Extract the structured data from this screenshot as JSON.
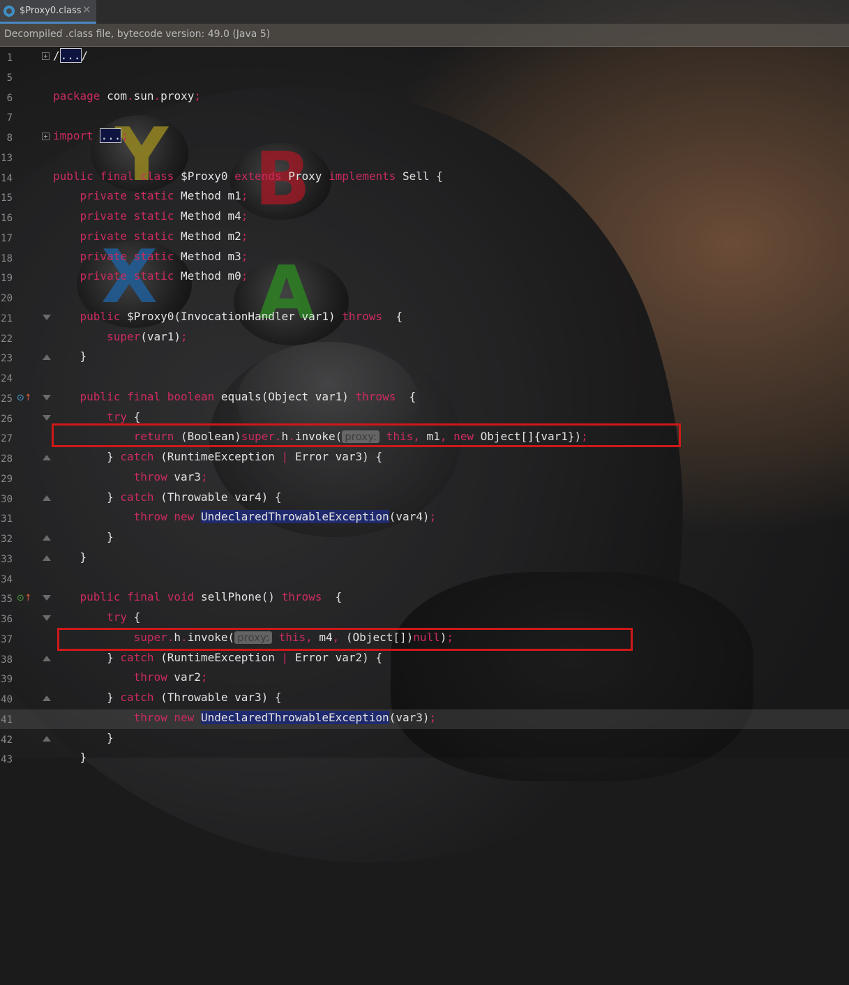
{
  "tab": {
    "icon": "class-file-icon",
    "label": "$Proxy0.class",
    "close": "✕"
  },
  "banner": {
    "text": "Decompiled .class file, bytecode version: 49.0 (Java 5)"
  },
  "hints": {
    "proxy": "proxy:"
  },
  "colors": {
    "keyword": "#cc2b5e",
    "identifier": "#e3e3e3",
    "selection": "#1f2a6e",
    "highlight_box": "#d01818"
  },
  "lines": [
    {
      "n": "1",
      "fold": "plus",
      "code": "/.../"
    },
    {
      "n": "5",
      "fold": "",
      "code": ""
    },
    {
      "n": "6",
      "fold": "",
      "code": "package com.sun.proxy;"
    },
    {
      "n": "7",
      "fold": "",
      "code": ""
    },
    {
      "n": "8",
      "fold": "plus",
      "code": "import ...;"
    },
    {
      "n": "13",
      "fold": "",
      "code": ""
    },
    {
      "n": "14",
      "fold": "",
      "code": "public final class $Proxy0 extends Proxy implements Sell {"
    },
    {
      "n": "15",
      "fold": "",
      "code": "    private static Method m1;"
    },
    {
      "n": "16",
      "fold": "",
      "code": "    private static Method m4;"
    },
    {
      "n": "17",
      "fold": "",
      "code": "    private static Method m2;"
    },
    {
      "n": "18",
      "fold": "",
      "code": "    private static Method m3;"
    },
    {
      "n": "19",
      "fold": "",
      "code": "    private static Method m0;"
    },
    {
      "n": "20",
      "fold": "",
      "code": ""
    },
    {
      "n": "21",
      "fold": "down",
      "code": "    public $Proxy0(InvocationHandler var1) throws  {"
    },
    {
      "n": "22",
      "fold": "",
      "code": "        super(var1);"
    },
    {
      "n": "23",
      "fold": "up",
      "code": "    }"
    },
    {
      "n": "24",
      "fold": "",
      "code": ""
    },
    {
      "n": "25",
      "fold": "down",
      "marker": "override",
      "code": "    public final boolean equals(Object var1) throws  {"
    },
    {
      "n": "26",
      "fold": "down",
      "code": "        try {"
    },
    {
      "n": "27",
      "fold": "",
      "code": "            return (Boolean)super.h.invoke(proxy: this, m1, new Object[]{var1});"
    },
    {
      "n": "28",
      "fold": "up",
      "code": "        } catch (RuntimeException | Error var3) {"
    },
    {
      "n": "29",
      "fold": "",
      "code": "            throw var3;"
    },
    {
      "n": "30",
      "fold": "up",
      "code": "        } catch (Throwable var4) {"
    },
    {
      "n": "31",
      "fold": "",
      "code": "            throw new UndeclaredThrowableException(var4);"
    },
    {
      "n": "32",
      "fold": "up",
      "code": "        }"
    },
    {
      "n": "33",
      "fold": "up",
      "code": "    }"
    },
    {
      "n": "34",
      "fold": "",
      "code": ""
    },
    {
      "n": "35",
      "fold": "down",
      "marker": "implement",
      "code": "    public final void sellPhone() throws  {"
    },
    {
      "n": "36",
      "fold": "down",
      "code": "        try {"
    },
    {
      "n": "37",
      "fold": "",
      "code": "            super.h.invoke(proxy: this, m4, (Object[])null);"
    },
    {
      "n": "38",
      "fold": "up",
      "code": "        } catch (RuntimeException | Error var2) {"
    },
    {
      "n": "39",
      "fold": "",
      "code": "            throw var2;"
    },
    {
      "n": "40",
      "fold": "up",
      "code": "        } catch (Throwable var3) {"
    },
    {
      "n": "41",
      "fold": "",
      "code": "            throw new UndeclaredThrowableException(var3);"
    },
    {
      "n": "42",
      "fold": "up",
      "code": "        }"
    },
    {
      "n": "43",
      "fold": "",
      "code": "    }"
    }
  ]
}
